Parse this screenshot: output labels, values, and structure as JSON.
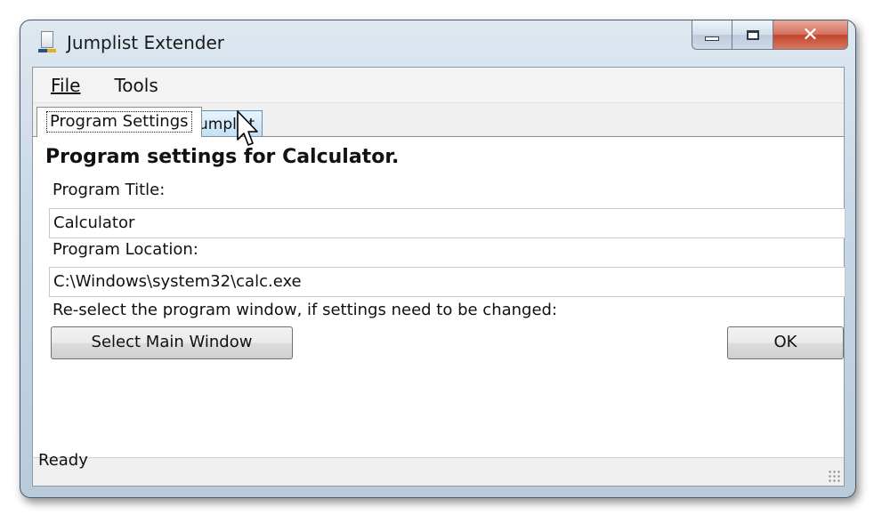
{
  "window": {
    "title": "Jumplist Extender",
    "close_glyph": "✕"
  },
  "menu": {
    "items": [
      "File",
      "Tools"
    ]
  },
  "tabs": [
    {
      "label": "Program Settings",
      "active": true
    },
    {
      "label": "Jumplist",
      "active": false
    }
  ],
  "settings": {
    "heading": "Program settings for Calculator.",
    "title_label": "Program Title:",
    "title_value": "Calculator",
    "location_label": "Program Location:",
    "location_value": "C:\\Windows\\system32\\calc.exe",
    "reselect_hint": "Re-select the program window, if settings need to be changed:",
    "select_button": "Select Main Window",
    "ok_button": "OK"
  },
  "status": {
    "text": "Ready"
  },
  "colors": {
    "titlebar": "#c9d8e6",
    "close_button": "#c0452c",
    "hover_tab": "#bfe0f7"
  },
  "icons": {
    "app": "app-icon",
    "cursor": "pointer-cursor-icon",
    "grip": "resize-grip-icon"
  }
}
